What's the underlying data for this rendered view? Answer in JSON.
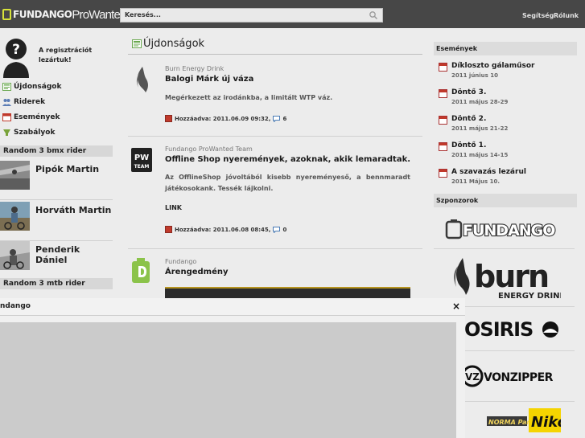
{
  "header": {
    "logo_bold": "FUNDANGO",
    "logo_thin": "ProWanted",
    "search_placeholder": "Keresés...",
    "links": [
      "Segítség",
      "Rólunk"
    ]
  },
  "left": {
    "registration_msg": "A regisztrációt lezártuk!",
    "nav": [
      {
        "label": "Újdonságok",
        "icon": "news-icon",
        "color": "#6aa84f"
      },
      {
        "label": "Riderek",
        "icon": "users-icon",
        "color": "#5b7db5"
      },
      {
        "label": "Események",
        "icon": "calendar-icon",
        "color": "#c0392b"
      },
      {
        "label": "Szabályok",
        "icon": "rules-icon",
        "color": "#79a33a"
      }
    ],
    "bmx_header": "Random 3 bmx rider",
    "bmx_riders": [
      "Pipók Martin",
      "Horváth Martin",
      "Penderik Dániel"
    ],
    "mtb_header": "Random 3 mtb rider"
  },
  "main": {
    "title": "Újdonságok",
    "news": [
      {
        "source": "Burn Energy Drink",
        "title": "Balogi Márk új váza",
        "text": "Megérkezett az irodánkba, a limitált WTP váz.",
        "meta": "Hozzáadva: 2011.06.09 09:32,",
        "comments": "6"
      },
      {
        "source": "Fundango ProWanted Team",
        "title": "Offline Shop nyeremények, azoknak, akik lemaradtak.",
        "text": "Az OfflineShop jóvoltából kisebb nyereményeső, a bennmaradt játékosokank. Tessék lájkolni.",
        "link": "LINK",
        "meta": "Hozzáadva: 2011.06.08 08:45,",
        "comments": "0",
        "icon_text_1": "PW",
        "icon_text_2": "TEAM"
      },
      {
        "source": "Fundango",
        "title": "Árengedmény"
      }
    ]
  },
  "right": {
    "events_header": "Események",
    "events": [
      {
        "title": "Díkloszto gálaműsor",
        "date": "2011 június 10"
      },
      {
        "title": "Döntő 3.",
        "date": "2011 május 28-29"
      },
      {
        "title": "Döntő 2.",
        "date": "2011 május 21-22"
      },
      {
        "title": "Döntő 1.",
        "date": "2011 május 14-15"
      },
      {
        "title": "A szavazás lezárul",
        "date": "2011 Május 10."
      }
    ],
    "sponsors_header": "Szponzorok",
    "sponsors": {
      "fundango": "FUNDANGO",
      "burn": "burn",
      "burn_sub": "ENERGY DRINK",
      "osiris": "OSIRIS",
      "vonzipper": "VONZIPPER",
      "norma": "NORMA Park",
      "nikon": "Nikon"
    }
  },
  "overlay": {
    "title": "ndango",
    "close": "×"
  }
}
